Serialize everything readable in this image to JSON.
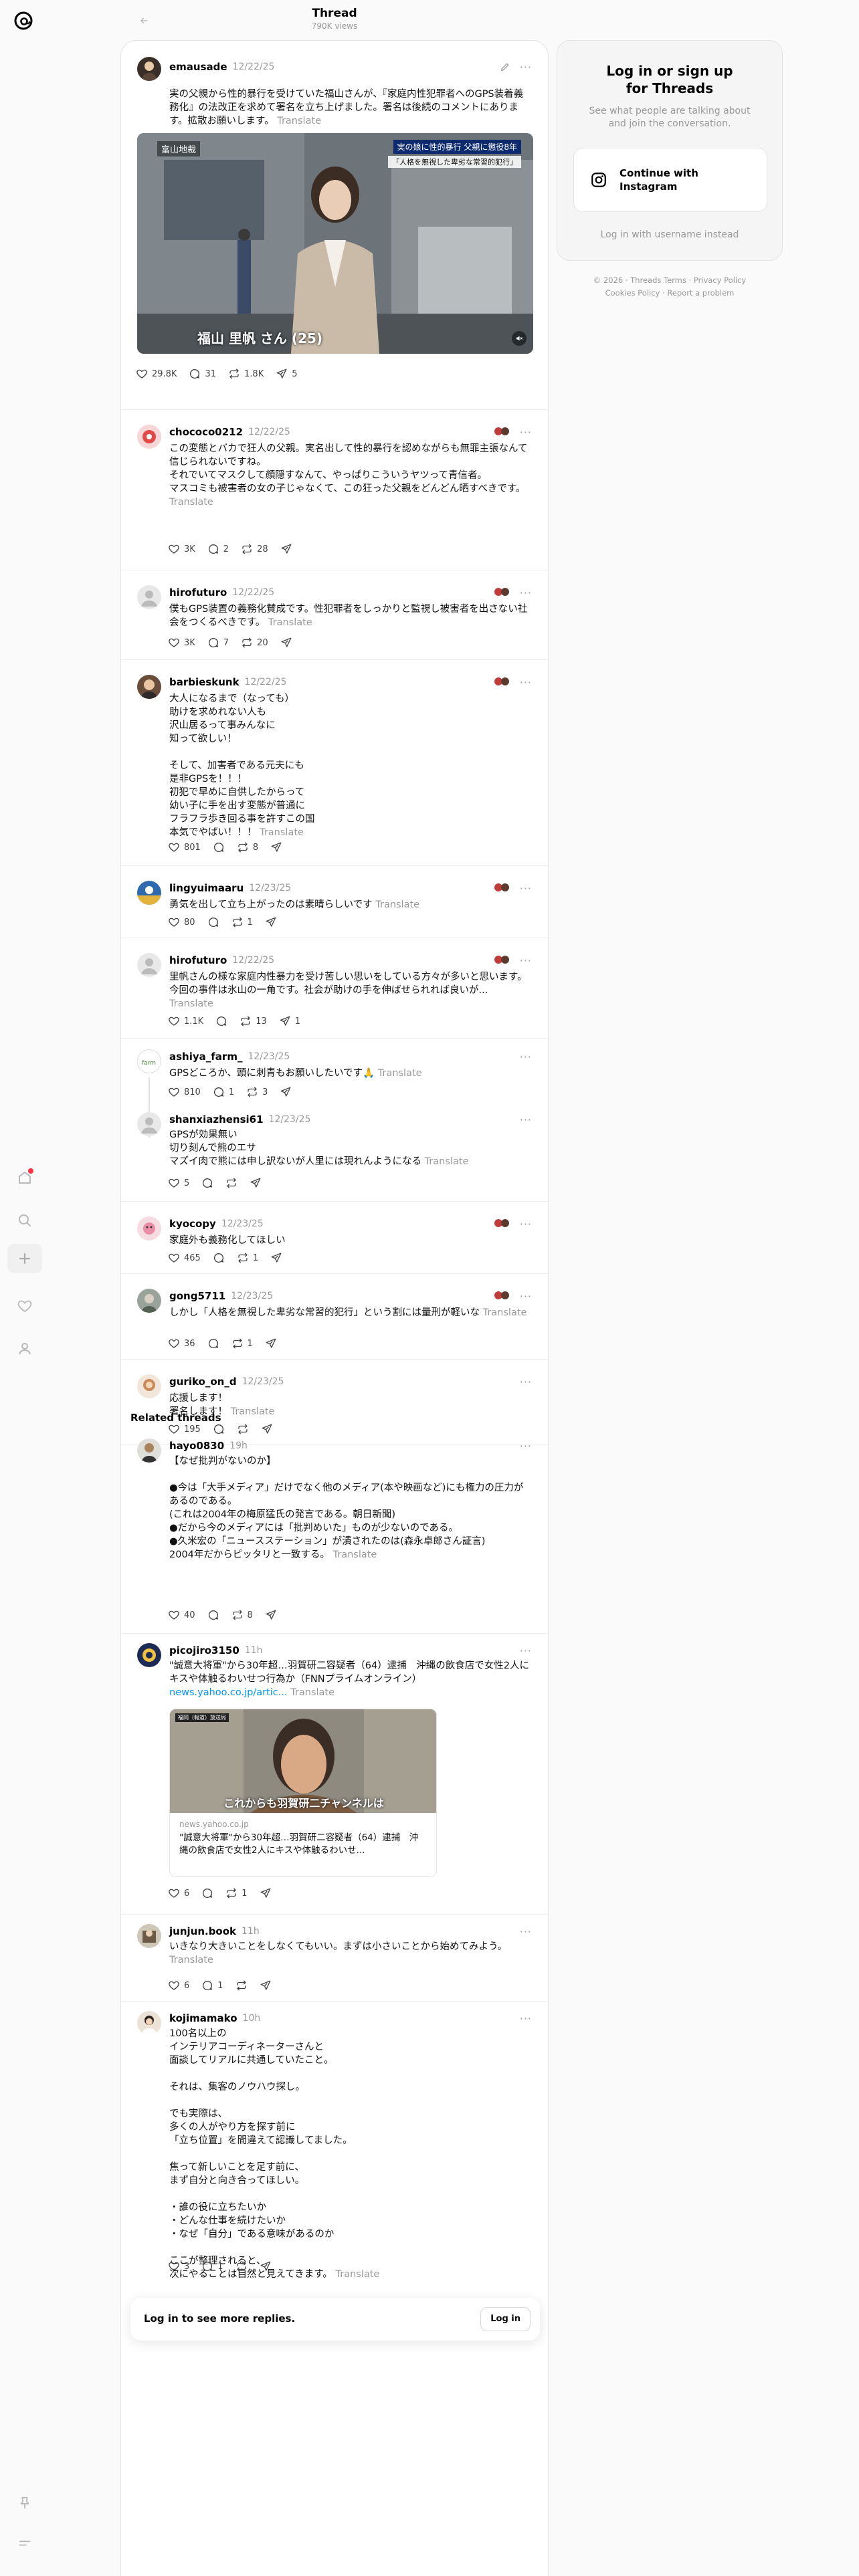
{
  "top": {
    "title": "Thread",
    "subtitle": "790K views"
  },
  "main_post": {
    "user": "emausade",
    "time": "12/22/25",
    "text": "実の父親から性的暴行を受けていた福山さんが、『家庭内性犯罪者へのGPS装着義務化』の法改正を求めて署名を立ち上げました。署名は後続のコメントにあります。拡散お願いします。",
    "translate": "Translate",
    "media_caption_left": "富山地裁",
    "media_caption_right_1": "実の娘に性的暴行 父親に懲役8年",
    "media_caption_right_2": "「人格を無視した卑劣な常習的犯行」",
    "media_name": "福山 里帆 さん (25)",
    "likes": "29.8K",
    "replies": "31",
    "reposts": "1.8K",
    "shares": "5"
  },
  "replies": [
    {
      "user": "chococo0212",
      "time": "12/22/25",
      "text": "この変態とバカで狂人の父親。実名出して性的暴行を認めながらも無罪主張なんて\n信じられないですね。\nそれでいてマスクして顔隠すなんて、やっぱりこういうヤツって青信者。\nマスコミも被害者の女の子じゃなくて、この狂った父親をどんどん晒すべきです。",
      "translate": "Translate",
      "likes": "3K",
      "replies": "2",
      "reposts": "28",
      "shares": ""
    },
    {
      "user": "hirofuturo",
      "time": "12/22/25",
      "text": "僕もGPS装置の義務化賛成です。性犯罪者をしっかりと監視し被害者を出さない社会をつくるべきです。",
      "translate": "Translate",
      "likes": "3K",
      "replies": "7",
      "reposts": "20",
      "shares": ""
    },
    {
      "user": "barbieskunk",
      "time": "12/22/25",
      "text": "大人になるまで（なっても）\n助けを求めれない人も\n沢山居るって事みんなに\n知って欲しい！\n\nそして、加害者である元夫にも\n是非GPSを！！！\n初犯で早めに自供したからって\n幼い子に手を出す変態が普通に\nフラフラ歩き回る事を許すこの国\n本気でやばい！！！",
      "translate": "Translate",
      "likes": "801",
      "replies": "",
      "reposts": "8",
      "shares": ""
    },
    {
      "user": "lingyuimaaru",
      "time": "12/23/25",
      "text": "勇気を出して立ち上がったのは素晴らしいです",
      "translate": "Translate",
      "likes": "80",
      "replies": "",
      "reposts": "1",
      "shares": ""
    },
    {
      "user": "hirofuturo",
      "time": "12/22/25",
      "text": "里帆さんの様な家庭内性暴力を受け苦しい思いをしている方々が多いと思います。今回の事件は氷山の一角です。社会が助けの手を伸ばせられれば良いが...",
      "translate": "Translate",
      "likes": "1.1K",
      "replies": "",
      "reposts": "13",
      "shares": "1"
    },
    {
      "user": "ashiya_farm_",
      "time": "12/23/25",
      "text": "GPSどころか、頭に刺青もお願いしたいです🙏",
      "translate": "Translate",
      "likes": "810",
      "replies": "1",
      "reposts": "3",
      "shares": ""
    },
    {
      "user": "shanxiazhensi61",
      "time": "12/23/25",
      "text": "GPSが効果無い\n切り刻んで熊のエサ\nマズイ肉で熊には申し訳ないが人里には現れんようになる",
      "translate": "Translate",
      "likes": "5",
      "replies": "",
      "reposts": "",
      "shares": ""
    },
    {
      "user": "kyocopy",
      "time": "12/23/25",
      "text": "家庭外も義務化してほしい",
      "translate": "",
      "likes": "465",
      "replies": "",
      "reposts": "1",
      "shares": ""
    },
    {
      "user": "gong5711",
      "time": "12/23/25",
      "text": "しかし「人格を無視した卑劣な常習的犯行」という割には量刑が軽いな",
      "translate": "Translate",
      "likes": "36",
      "replies": "",
      "reposts": "1",
      "shares": ""
    },
    {
      "user": "guriko_on_d",
      "time": "12/23/25",
      "text": "応援します！\n署名します！",
      "translate": "Translate",
      "likes": "195",
      "replies": "",
      "reposts": "",
      "shares": ""
    }
  ],
  "related": {
    "title": "Related threads",
    "posts": [
      {
        "user": "hayo0830",
        "time": "19h",
        "text": "【なぜ批判がないのか】\n\n●今は「大手メディア」だけでなく他のメディア(本や映画など)にも権力の圧力があるのである。\n(これは2004年の梅原猛氏の発言である。朝日新聞)\n●だから今のメディアには「批判めいた」ものが少ないのである。\n●久米宏の「ニュースステーション」が潰されたのは(森永卓郎さん証言)\n2004年だからピッタリと一致する。",
        "translate": "Translate",
        "likes": "40",
        "replies": "",
        "reposts": "8",
        "shares": ""
      },
      {
        "user": "picojiro3150",
        "time": "11h",
        "text": "\"誠意大将軍\"から30年超…羽賀研二容疑者（64）逮捕　沖縄の飲食店で女性2人にキスや体触るわいせつ行為か（FNNプライムオンライン）",
        "link": "news.yahoo.co.jp/artic...",
        "translate": "Translate",
        "card_domain": "news.yahoo.co.jp",
        "card_title": "\"誠意大将軍\"から30年超…羽賀研二容疑者（64）逮捕　沖縄の飲食店で女性2人にキスや体触るわいせ...",
        "card_badge": "福岡（報道）放送局",
        "card_caption": "これからも羽賀研二チャンネルは",
        "likes": "6",
        "replies": "",
        "reposts": "1",
        "shares": ""
      },
      {
        "user": "junjun.book",
        "time": "11h",
        "text": "いきなり大きいことをしなくてもいい。まずは小さいことから始めてみよう。",
        "translate": "Translate",
        "likes": "6",
        "replies": "1",
        "reposts": "",
        "shares": ""
      },
      {
        "user": "kojimamako",
        "time": "10h",
        "text": "100名以上の\nインテリアコーディネーターさんと\n面談してリアルに共通していたこと。\n\nそれは、集客のノウハウ探し。\n\nでも実際は、\n多くの人がやり方を探す前に\n「立ち位置」を間違えて認識してました。\n\n焦って新しいことを足す前に、\nまず自分と向き合ってほしい。\n\n・誰の役に立ちたいか\n・どんな仕事を続けたいか\n・なぜ「自分」である意味があるのか\n\nここが整理されると、\n次にやることは自然と見えてきます。",
        "translate": "Translate",
        "likes": "3",
        "replies": "1",
        "reposts": "",
        "shares": ""
      }
    ]
  },
  "login_bar": {
    "text": "Log in to see more replies.",
    "button": "Log in"
  },
  "side_panel": {
    "title": "Log in or sign up\nfor Threads",
    "subtitle": "See what people are talking about\nand join the conversation.",
    "button": "Continue with\nInstagram",
    "alt": "Log in with username instead"
  },
  "footer": {
    "line1": "© 2026 · Threads Terms · Privacy Policy",
    "line2": "Cookies Policy · Report a problem"
  },
  "colors": {
    "notification": "#ff3040",
    "link": "#0095f6",
    "muted": "#999999"
  }
}
